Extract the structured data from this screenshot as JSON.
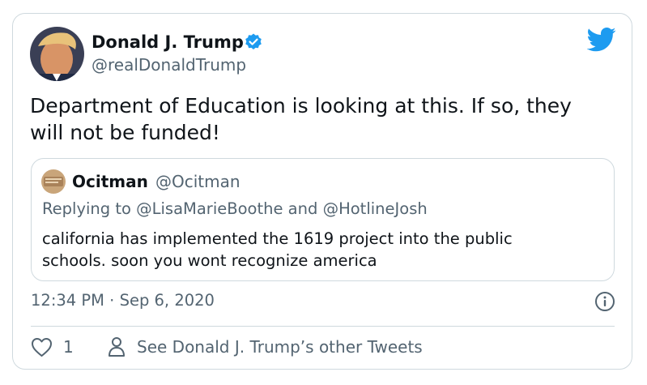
{
  "author": {
    "name": "Donald J. Trump",
    "handle": "@realDonaldTrump"
  },
  "tweet": {
    "text_line1": "Department of Education is looking at this. If so, they",
    "text_line2": "will not be funded!",
    "timestamp": "12:34 PM · Sep 6, 2020"
  },
  "quoted_tweet": {
    "name": "Ocitman",
    "handle": "@Ocitman",
    "reply_prefix": "Replying to ",
    "reply_user1": "@LisaMarieBoothe",
    "reply_and": " and ",
    "reply_user2": "@HotlineJosh",
    "text_line1": "california has implemented the 1619 project into the public",
    "text_line2": "schools. soon you wont recognize america"
  },
  "actions": {
    "like_count": "1",
    "other_tweets_label": "See Donald J. Trump’s other Tweets"
  },
  "colors": {
    "twitter_blue": "#1d9bf0",
    "secondary_text": "#536471",
    "border": "#cfd9de"
  },
  "icons": [
    "avatar",
    "verified-badge-icon",
    "twitter-bird-icon",
    "info-icon",
    "heart-icon",
    "person-icon"
  ]
}
